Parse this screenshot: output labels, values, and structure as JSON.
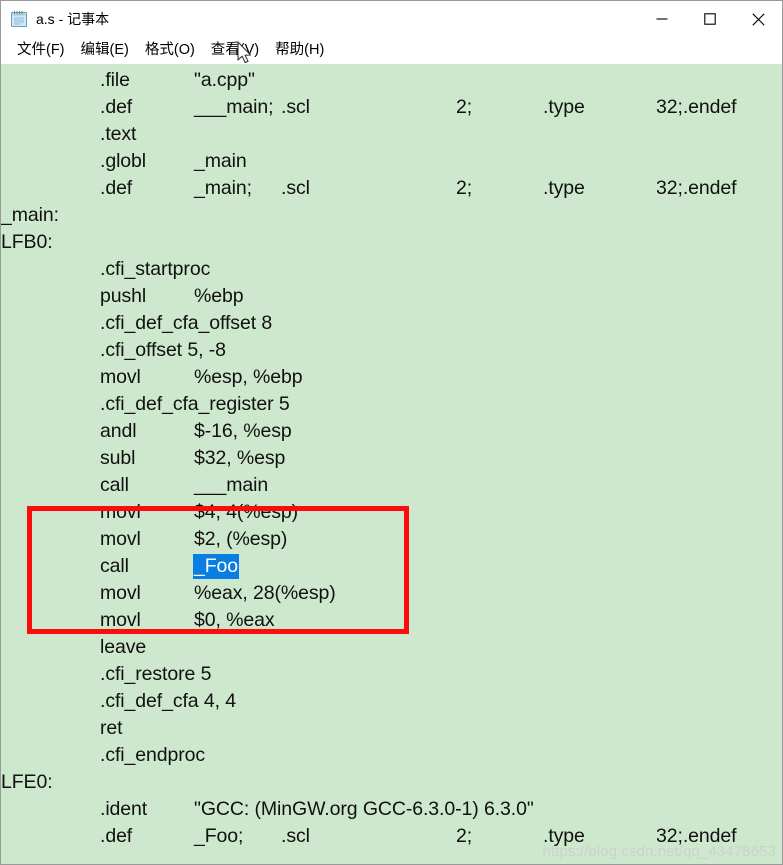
{
  "window": {
    "title": "a.s - 记事本",
    "icon": "notepad-icon",
    "controls": {
      "minimize": "—",
      "maximize": "□",
      "close": "✕"
    }
  },
  "menubar": {
    "items": [
      {
        "label": "文件(F)",
        "name": "file"
      },
      {
        "label": "编辑(E)",
        "name": "edit"
      },
      {
        "label": "格式(O)",
        "name": "format"
      },
      {
        "label": "查看(V)",
        "name": "view"
      },
      {
        "label": "帮助(H)",
        "name": "help"
      }
    ]
  },
  "editor": {
    "background_color": "#cde8cd",
    "selection_color": "#0a7de3",
    "selection_text": "_Foo",
    "lines": [
      {
        "cols": [
          "",
          ".file",
          "\"a.cpp\""
        ]
      },
      {
        "cols": [
          "",
          ".def",
          "___main;",
          ".scl",
          "2;",
          ".type",
          "32;",
          ".endef"
        ]
      },
      {
        "cols": [
          "",
          ".text"
        ]
      },
      {
        "cols": [
          "",
          ".globl",
          "_main"
        ]
      },
      {
        "cols": [
          "",
          ".def",
          "_main;",
          ".scl",
          "2;",
          ".type",
          "32;",
          ".endef"
        ]
      },
      {
        "label": "_main:"
      },
      {
        "label": "LFB0:"
      },
      {
        "cols": [
          "",
          ".cfi_startproc"
        ]
      },
      {
        "cols": [
          "",
          "pushl",
          "%ebp"
        ]
      },
      {
        "cols": [
          "",
          ".cfi_def_cfa_offset 8"
        ]
      },
      {
        "cols": [
          "",
          ".cfi_offset 5, -8"
        ]
      },
      {
        "cols": [
          "",
          "movl",
          "%esp, %ebp"
        ]
      },
      {
        "cols": [
          "",
          ".cfi_def_cfa_register 5"
        ]
      },
      {
        "cols": [
          "",
          "andl",
          "$-16, %esp"
        ]
      },
      {
        "cols": [
          "",
          "subl",
          "$32, %esp"
        ]
      },
      {
        "cols": [
          "",
          "call",
          "___main"
        ]
      },
      {
        "cols": [
          "",
          "movl",
          "$4, 4(%esp)"
        ]
      },
      {
        "cols": [
          "",
          "movl",
          "$2, (%esp)"
        ]
      },
      {
        "cols": [
          "",
          "call",
          "_Foo"
        ],
        "selected_col": 2
      },
      {
        "cols": [
          "",
          "movl",
          "%eax, 28(%esp)"
        ]
      },
      {
        "cols": [
          "",
          "movl",
          "$0, %eax"
        ]
      },
      {
        "cols": [
          "",
          "leave"
        ]
      },
      {
        "cols": [
          "",
          ".cfi_restore 5"
        ]
      },
      {
        "cols": [
          "",
          ".cfi_def_cfa 4, 4"
        ]
      },
      {
        "cols": [
          "",
          "ret"
        ]
      },
      {
        "cols": [
          "",
          ".cfi_endproc"
        ]
      },
      {
        "label": "LFE0:"
      },
      {
        "cols": [
          "",
          ".ident",
          "\"GCC: (MinGW.org GCC-6.3.0-1) 6.3.0\""
        ]
      },
      {
        "cols": [
          "",
          ".def",
          "_Foo;",
          ".scl",
          "2;",
          ".type",
          "32;",
          ".endef"
        ]
      }
    ]
  },
  "annotation": {
    "red_box_color": "#fb0d0d",
    "highlighted_lines": [
      "movl      $4, 4(%esp)",
      "movl      $2, (%esp)",
      "call      _Foo",
      "movl      %eax, 28(%esp)",
      "movl      $0, %eax"
    ]
  },
  "watermark": {
    "text": "https://blog.csdn.net/qq_43478653"
  }
}
